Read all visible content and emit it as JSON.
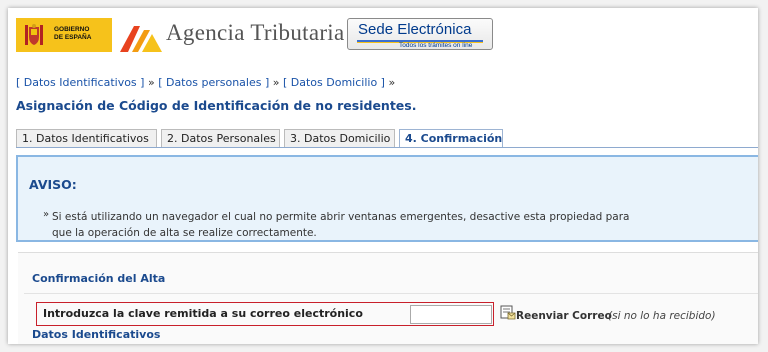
{
  "header": {
    "gov_logo_lines": [
      "GOBIERNO",
      "DE ESPAÑA"
    ],
    "agency_title": "Agencia Tributaria",
    "sede_title_1": "Sede ",
    "sede_title_2": "Electrónica",
    "sede_subtitle": "Todos los trámites on line"
  },
  "breadcrumb": {
    "items": [
      "[ Datos Identificativos ]",
      "[ Datos personales ]",
      "[ Datos Domicilio ]"
    ],
    "separator": "»"
  },
  "page_title": "Asignación de Código de Identificación de no residentes.",
  "tabs": [
    {
      "label": "1. Datos Identificativos"
    },
    {
      "label": "2. Datos Personales"
    },
    {
      "label": "3. Datos Domicilio"
    },
    {
      "label": "4. Confirmación"
    }
  ],
  "aviso": {
    "title": "AVISO:",
    "bullet": "»",
    "text": "Si está utilizando un navegador el cual no permite abrir ventanas emergentes, desactive esta propiedad para que la operación de alta se realize correctamente."
  },
  "confirmation": {
    "header": "Confirmación del Alta",
    "key_label": "Introduzca la clave remitida a su correo electrónico",
    "key_value": "",
    "resend_label": "Reenviar Correo",
    "resend_note": "(si no lo ha recibido)",
    "next_section": "Datos Identificativos"
  },
  "colors": {
    "accent": "#1b4a8e",
    "highlight_border": "#c8202b",
    "aviso_background": "#e9f3fb"
  }
}
